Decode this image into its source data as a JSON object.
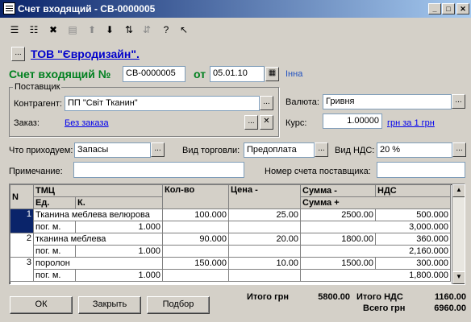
{
  "window": {
    "title": "Счет входящий - СВ-0000005",
    "btn_min": "_",
    "btn_max": "□",
    "btn_close": "✕"
  },
  "header": {
    "org_btn": "...",
    "org_name": "ТОВ \"Євродизайн\".",
    "doc_label": "Счет входящий №",
    "doc_no": "СВ-0000005",
    "date_label": "от",
    "date": "05.01.10",
    "extra": "Інна"
  },
  "supplier": {
    "group_label": "Поставщик",
    "contractor_label": "Контрагент:",
    "contractor": "ПП \"Світ Тканин\"",
    "order_label": "Заказ:",
    "order_value": "Без заказа",
    "currency_label": "Валюта:",
    "currency": "Гривня",
    "rate_label": "Курс:",
    "rate": "1.00000",
    "rate_note": "грн за 1 грн"
  },
  "options": {
    "what_label": "Что приходуем:",
    "what": "Запасы",
    "trade_label": "Вид торговли:",
    "trade": "Предоплата",
    "vat_label": "Вид НДС:",
    "vat": "20 %",
    "note_label": "Примечание:",
    "note": "",
    "supplier_no_label": "Номер счета поставщика:",
    "supplier_no": ""
  },
  "table": {
    "headers": {
      "n": "N",
      "item": "ТМЦ",
      "unit": "Ед.",
      "k": "К.",
      "qty": "Кол-во",
      "price": "Цена -",
      "sum": "Сумма -",
      "vat": "НДС",
      "sum_plus": "Сумма +"
    },
    "rows": [
      {
        "n": "1",
        "name": "Тканина меблева велюрова",
        "unit": "пог. м.",
        "k": "1.000",
        "qty": "100.000",
        "price": "25.00",
        "sum": "2500.00",
        "vat": "500.000",
        "total": "3,000.000"
      },
      {
        "n": "2",
        "name": "тканина  меблева",
        "unit": "пог. м.",
        "k": "1.000",
        "qty": "90.000",
        "price": "20.00",
        "sum": "1800.00",
        "vat": "360.000",
        "total": "2,160.000"
      },
      {
        "n": "3",
        "name": "поролон",
        "unit": "пог. м.",
        "k": "1.000",
        "qty": "150.000",
        "price": "10.00",
        "sum": "1500.00",
        "vat": "300.000",
        "total": "1,800.000"
      }
    ]
  },
  "footer": {
    "ok": "ОК",
    "close": "Закрыть",
    "select": "Подбор",
    "total_label": "Итого грн",
    "total": "5800.00",
    "vat_label": "Итого НДС",
    "vat_total": "1160.00",
    "grand_label": "Всего грн",
    "grand_total": "6960.00"
  }
}
